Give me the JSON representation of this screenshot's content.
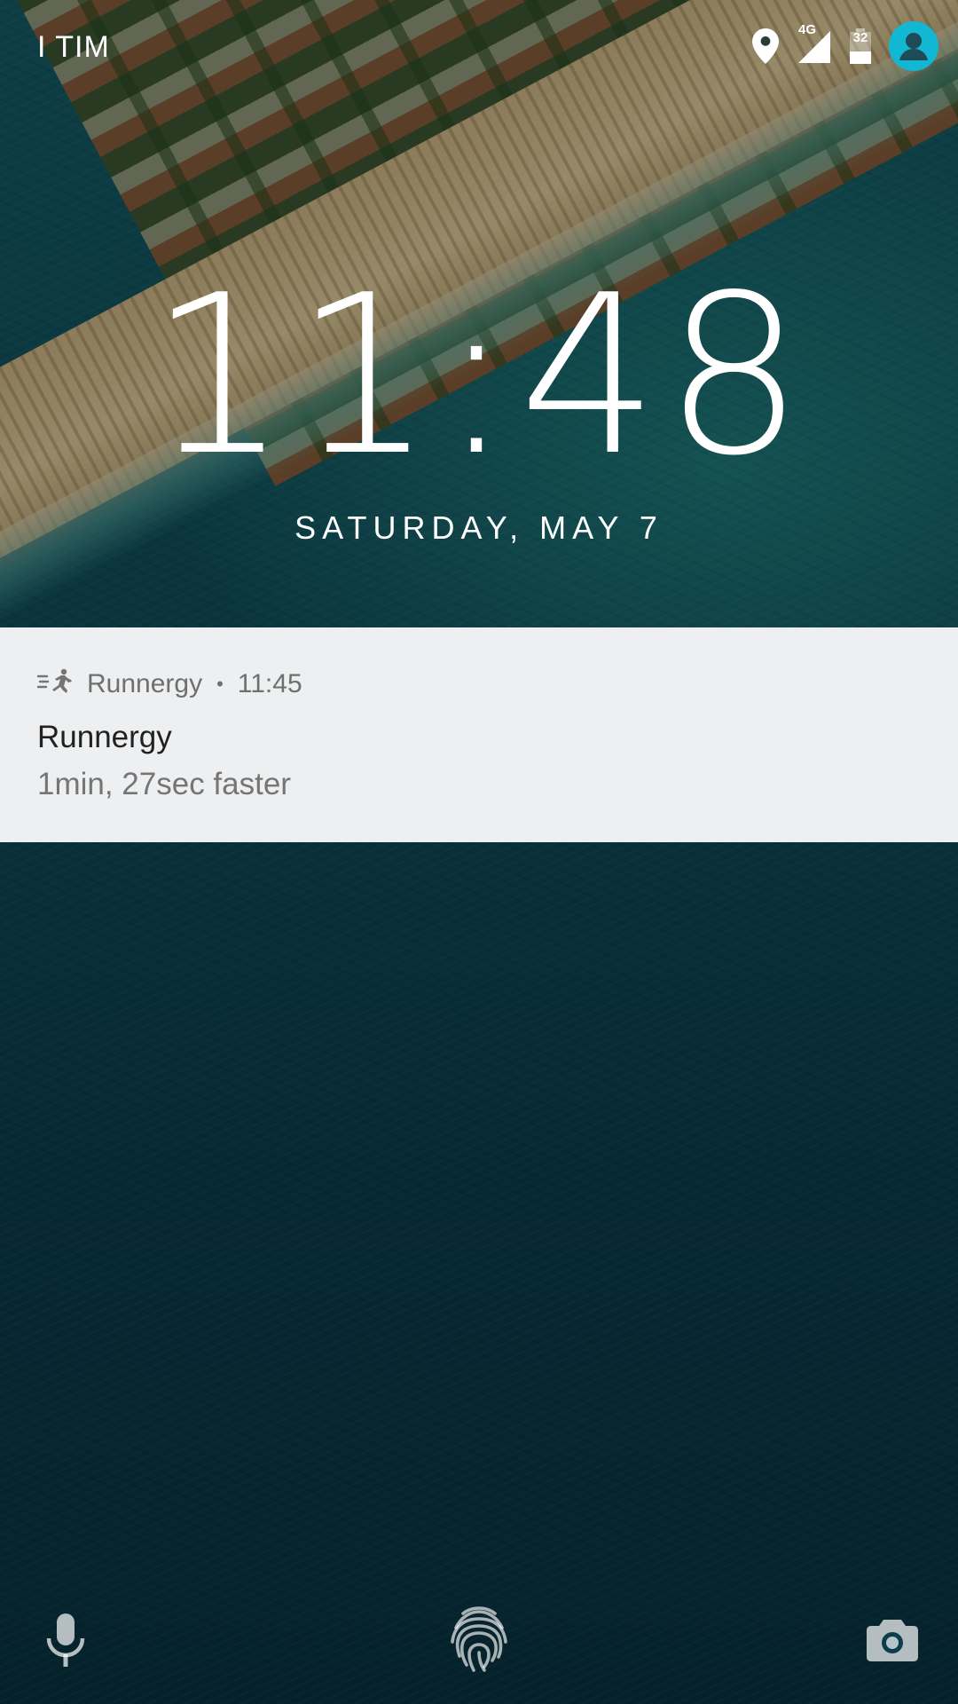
{
  "status_bar": {
    "carrier": "I TIM",
    "network_badge": "4G",
    "battery_level": "32",
    "icons": [
      "location-icon",
      "signal-icon",
      "battery-icon",
      "user-avatar-icon"
    ],
    "avatar_color": "#11b7d3"
  },
  "lock_screen": {
    "time": "11:48",
    "date": "SATURDAY, MAY 7"
  },
  "notification": {
    "app_icon": "runner-icon",
    "app_name": "Runnergy",
    "separator": "•",
    "time": "11:45",
    "title": "Runnergy",
    "text": "1min, 27sec faster",
    "background": "#eeeff0"
  },
  "bottom_bar": {
    "left": "microphone-icon",
    "center": "fingerprint-icon",
    "right": "camera-icon"
  }
}
